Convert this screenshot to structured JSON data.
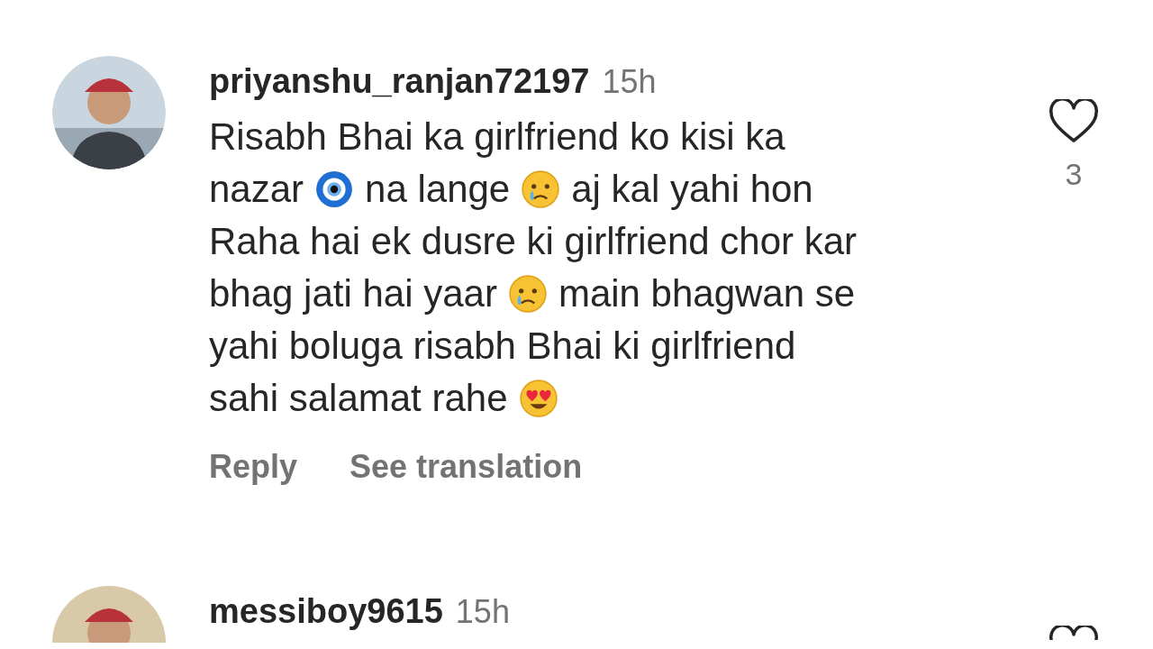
{
  "comments": [
    {
      "username": "priyanshu_ranjan72197",
      "time": "15h",
      "liked": false,
      "likes": "3",
      "lines": [
        [
          {
            "kind": "text",
            "text": "Risabh Bhai ka girlfriend ko kisi ka"
          }
        ],
        [
          {
            "kind": "text",
            "text": "nazar"
          },
          {
            "kind": "amulet"
          },
          {
            "kind": "text",
            "text": "na lange"
          },
          {
            "kind": "crying"
          },
          {
            "kind": "text",
            "text": "aj kal yahi hon"
          }
        ],
        [
          {
            "kind": "text",
            "text": "Raha hai ek dusre ki girlfriend chor kar"
          }
        ],
        [
          {
            "kind": "text",
            "text": "bhag jati hai yaar"
          },
          {
            "kind": "crying"
          },
          {
            "kind": "text",
            "text": "main bhagwan se"
          }
        ],
        [
          {
            "kind": "text",
            "text": "yahi boluga risabh Bhai ki girlfriend"
          }
        ],
        [
          {
            "kind": "text",
            "text": "sahi salamat rahe"
          },
          {
            "kind": "heart_eyes"
          }
        ]
      ],
      "actions": [
        "Reply",
        "See translation"
      ]
    },
    {
      "username": "messiboy9615",
      "time": "15h",
      "liked": false
    }
  ]
}
